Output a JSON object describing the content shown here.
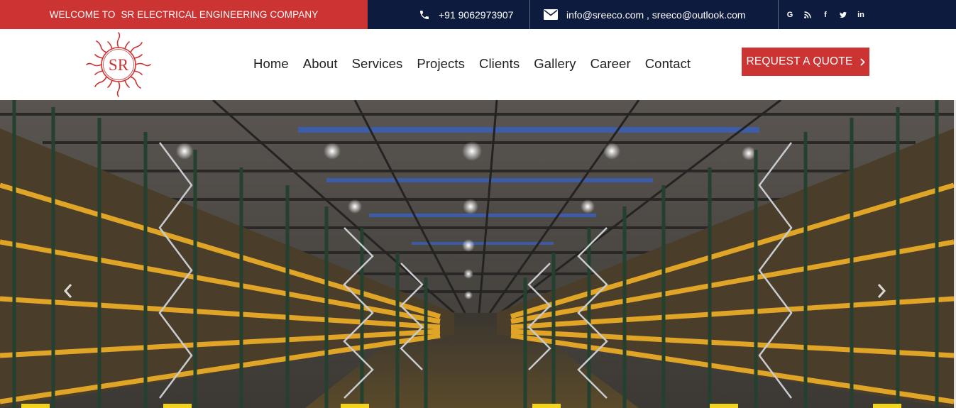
{
  "topbar": {
    "welcome_prefix": "WELCOME TO",
    "welcome_company": "SR ELECTRICAL ENGINEERING COMPANY",
    "phone": "+91 9062973907",
    "email": "info@sreeco.com , sreeco@outlook.com",
    "social_icons": [
      "google-icon",
      "rss-icon",
      "facebook-icon",
      "twitter-icon",
      "linkedin-icon"
    ],
    "social_glyphs": {
      "google": "G",
      "facebook": "f",
      "linkedin": "in"
    }
  },
  "logo": {
    "text": "SR"
  },
  "nav": {
    "items": [
      "Home",
      "About",
      "Services",
      "Projects",
      "Clients",
      "Gallery",
      "Career",
      "Contact"
    ]
  },
  "cta": {
    "label": "REQUEST A QUOTE"
  },
  "hero": {
    "alt_subject": "warehouse racking"
  },
  "colors": {
    "brand_red": "#cc3333",
    "navy": "#0d1b3e",
    "rack_yellow": "#e0a526"
  }
}
